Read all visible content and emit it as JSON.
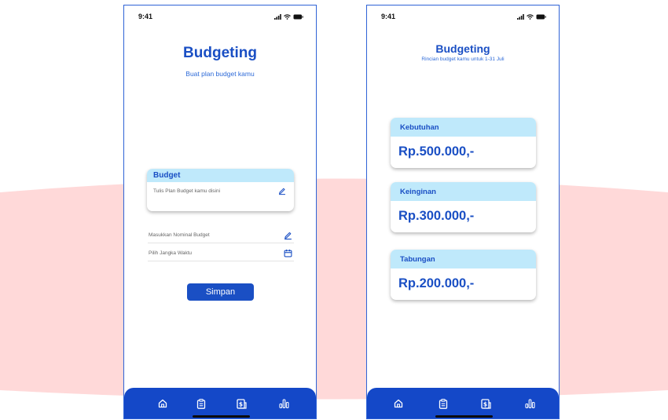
{
  "colors": {
    "primary": "#1a4fc4",
    "nav_background": "#1448c8",
    "card_header": "#bfe9fb",
    "background_band": "#ffd9d9",
    "frame_border": "#2f63d6"
  },
  "screen_1": {
    "status_time": "9:41",
    "title": "Budgeting",
    "subtitle": "Buat plan budget kamu",
    "budget_card": {
      "header": "Budget",
      "placeholder": "Tulis Plan Budget kamu disini",
      "icon": "pencil-icon"
    },
    "fields": [
      {
        "placeholder": "Masukkan Nominal Budget",
        "icon": "pencil-icon"
      },
      {
        "placeholder": "Pilih Jangka Waktu",
        "icon": "calendar-icon"
      }
    ],
    "save_label": "Simpan"
  },
  "screen_2": {
    "status_time": "9:41",
    "title": "Budgeting",
    "subtitle": "Rincian budget kamu untuk 1-31 Juli",
    "categories": [
      {
        "label": "Kebutuhan",
        "amount": "Rp.500.000,-"
      },
      {
        "label": "Keinginan",
        "amount": "Rp.300.000,-"
      },
      {
        "label": "Tabungan",
        "amount": "Rp.200.000,-"
      }
    ]
  },
  "bottom_nav": {
    "items": [
      "home-icon",
      "clipboard-icon",
      "money-icon",
      "chart-icon"
    ]
  }
}
